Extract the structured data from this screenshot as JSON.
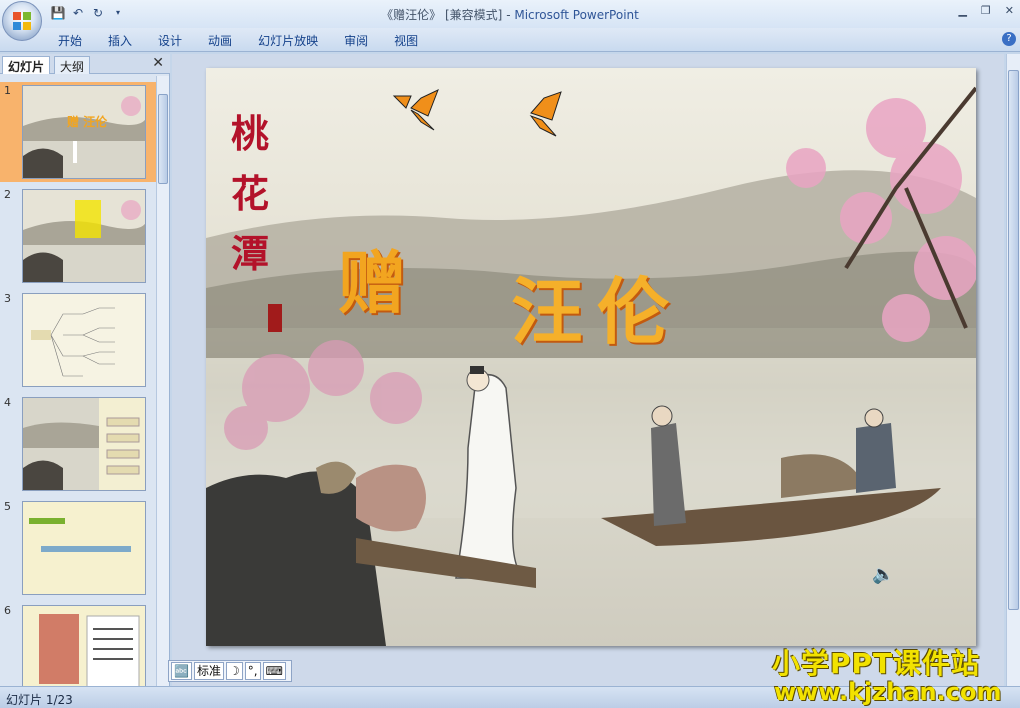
{
  "window": {
    "title_doc": "《赠汪伦》",
    "title_mode": "[兼容模式]",
    "title_app": "Microsoft PowerPoint"
  },
  "ribbon": {
    "tabs": [
      "开始",
      "插入",
      "设计",
      "动画",
      "幻灯片放映",
      "审阅",
      "视图"
    ]
  },
  "left_pane": {
    "tabs": [
      "幻灯片",
      "大纲"
    ],
    "close": "✕",
    "slides": [
      {
        "num": "1",
        "selected": true
      },
      {
        "num": "2",
        "selected": false
      },
      {
        "num": "3",
        "selected": false
      },
      {
        "num": "4",
        "selected": false
      },
      {
        "num": "5",
        "selected": false
      },
      {
        "num": "6",
        "selected": false
      }
    ]
  },
  "slide": {
    "vertical_title": [
      "桃",
      "花",
      "潭"
    ],
    "poem_word1": "赠",
    "poem_word2": "汪伦",
    "colors": {
      "title_orange": "#f2a520",
      "vertical_red": "#b3122a"
    }
  },
  "view_bar": {
    "label": "标准"
  },
  "status": {
    "slide_counter": "幻灯片 1/23"
  },
  "watermark": {
    "line1": "小学PPT课件站",
    "line2": "www.kjzhan.com"
  }
}
